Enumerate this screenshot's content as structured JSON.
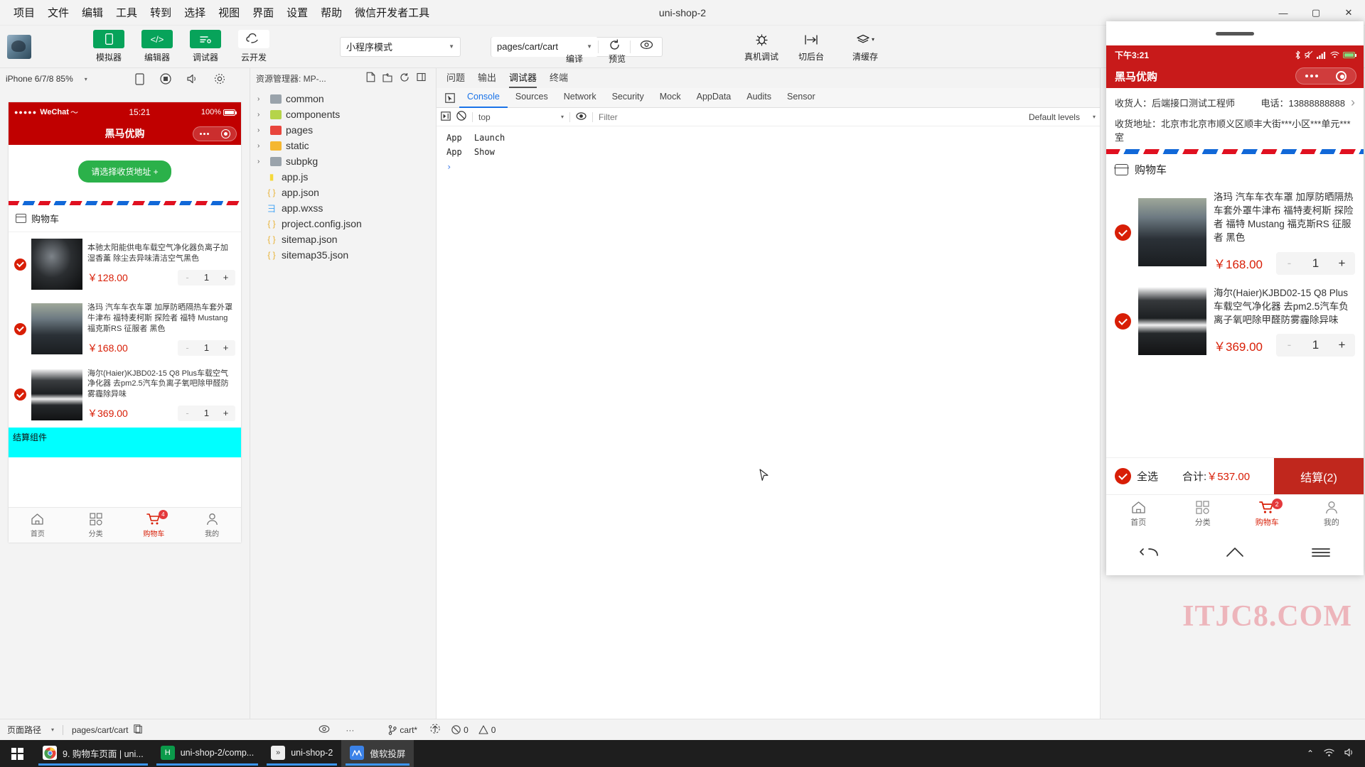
{
  "window": {
    "title": "uni-shop-2",
    "controls": {
      "minimize": "—",
      "maximize": "▢",
      "close": "✕"
    }
  },
  "menubar": [
    "项目",
    "文件",
    "编辑",
    "工具",
    "转到",
    "选择",
    "视图",
    "界面",
    "设置",
    "帮助",
    "微信开发者工具"
  ],
  "toolbar": {
    "tools": [
      {
        "label": "模拟器",
        "icon": "phone-icon"
      },
      {
        "label": "编辑器",
        "icon": "code-icon"
      },
      {
        "label": "调试器",
        "icon": "debug-icon"
      },
      {
        "label": "云开发",
        "icon": "cloud-icon"
      }
    ],
    "mode_select": "小程序模式",
    "page_select": "pages/cart/cart",
    "compile": {
      "label": "编译",
      "icon": "refresh-icon"
    },
    "preview": {
      "label": "预览",
      "icon": "eye-icon"
    },
    "actions": [
      {
        "label": "真机调试",
        "icon": "bug-icon"
      },
      {
        "label": "切后台",
        "icon": "switch-icon"
      },
      {
        "label": "清缓存",
        "icon": "layers-icon",
        "caret": "▾"
      }
    ]
  },
  "simulator": {
    "device": "iPhone 6/7/8 85%",
    "device_caret": "▾",
    "icons": [
      "phone-rotate-icon",
      "record-icon",
      "volume-icon",
      "settings-icon"
    ],
    "status": {
      "carrier": "WeChat",
      "dots": "●●●●●",
      "time": "15:21",
      "battery": "100%"
    },
    "nav_title": "黑马优购",
    "address_button": "请选择收货地址 +",
    "cart_header": "购物车",
    "items": [
      {
        "name": "本驰太阳能供电车载空气净化器负离子加湿香薰 除尘去异味清洁空气黑色",
        "price": "￥128.00",
        "qty": "1",
        "minus": "-",
        "plus": "+",
        "checked": true,
        "thumb": "t1"
      },
      {
        "name": "洛玛 汽车车衣车罩 加厚防晒隔热车套外罩牛津布 福特麦柯斯 探险者 福特 Mustang 福克斯RS 征服者 黑色",
        "price": "￥168.00",
        "qty": "1",
        "minus": "-",
        "plus": "+",
        "checked": true,
        "thumb": "t2"
      },
      {
        "name": "海尔(Haier)KJBD02-15 Q8 Plus车载空气净化器 去pm2.5汽车负离子氧吧除甲醛防雾霾除异味",
        "price": "￥369.00",
        "qty": "1",
        "minus": "-",
        "plus": "+",
        "checked": true,
        "thumb": "t3"
      }
    ],
    "settle_component": "结算组件",
    "tabbar": [
      {
        "label": "首页",
        "icon": "home-icon",
        "active": false,
        "badge": ""
      },
      {
        "label": "分类",
        "icon": "grid-icon",
        "active": false,
        "badge": ""
      },
      {
        "label": "购物车",
        "icon": "cart-icon",
        "active": true,
        "badge": "4"
      },
      {
        "label": "我的",
        "icon": "user-icon",
        "active": false,
        "badge": ""
      }
    ]
  },
  "explorer": {
    "title": "资源管理器: MP-...",
    "head_icons": [
      "new-file-icon",
      "new-folder-icon",
      "refresh-icon",
      "collapse-icon"
    ],
    "tree": [
      {
        "label": "common",
        "type": "folder",
        "color": "#9aa3ab",
        "arrow": "›"
      },
      {
        "label": "components",
        "type": "folder",
        "color": "#b5d44a",
        "arrow": "›"
      },
      {
        "label": "pages",
        "type": "folder",
        "color": "#e8453c",
        "arrow": "›"
      },
      {
        "label": "static",
        "type": "folder",
        "color": "#f5b731",
        "arrow": "›"
      },
      {
        "label": "subpkg",
        "type": "folder",
        "color": "#9aa3ab",
        "arrow": "›"
      },
      {
        "label": "app.js",
        "type": "js",
        "color": "#f5d93a",
        "glyph": "▮"
      },
      {
        "label": "app.json",
        "type": "json",
        "color": "#e8b339",
        "glyph": "{ }"
      },
      {
        "label": "app.wxss",
        "type": "wxss",
        "color": "#3aa0f5",
        "glyph": "彐"
      },
      {
        "label": "project.config.json",
        "type": "json",
        "color": "#e8b339",
        "glyph": "{ }"
      },
      {
        "label": "sitemap.json",
        "type": "json",
        "color": "#e8b339",
        "glyph": "{ }"
      },
      {
        "label": "sitemap35.json",
        "type": "json",
        "color": "#e8b339",
        "glyph": "{ }"
      }
    ]
  },
  "devtools": {
    "panel_tabs": [
      {
        "label": "问题",
        "active": false
      },
      {
        "label": "输出",
        "active": false
      },
      {
        "label": "调试器",
        "active": true
      },
      {
        "label": "终端",
        "active": false
      }
    ],
    "inspect_icon": "inspect-icon",
    "tabs": [
      {
        "label": "Console",
        "active": true
      },
      {
        "label": "Sources",
        "active": false
      },
      {
        "label": "Network",
        "active": false
      },
      {
        "label": "Security",
        "active": false
      },
      {
        "label": "Mock",
        "active": false
      },
      {
        "label": "AppData",
        "active": false
      },
      {
        "label": "Audits",
        "active": false
      },
      {
        "label": "Sensor",
        "active": false
      }
    ],
    "console_bar": {
      "exec_icon": "execute-icon",
      "clear_icon": "clear-icon",
      "context": "top",
      "context_caret": "▾",
      "eye_icon": "eye-icon",
      "filter_placeholder": "Filter",
      "levels": "Default levels",
      "levels_caret": "▾"
    },
    "logs": [
      {
        "key": "App",
        "text": "Launch"
      },
      {
        "key": "App",
        "text": "Show"
      }
    ],
    "prompt": "›"
  },
  "mirror": {
    "status": {
      "time": "下午3:21",
      "icons": [
        "bluetooth-icon",
        "mute-icon",
        "signal-icon",
        "wifi-icon",
        "battery-icon"
      ]
    },
    "nav_title": "黑马优购",
    "address": {
      "receiver_label": "收货人：后端接口测试工程师",
      "phone_label": "电话：13888888888",
      "chevron": "›",
      "address_label": "收货地址：北京市北京市顺义区顺丰大街***小区***单元***室"
    },
    "cart_header": "购物车",
    "items": [
      {
        "name": "洛玛 汽车车衣车罩 加厚防晒隔热车套外罩牛津布 福特麦柯斯 探险者 福特 Mustang 福克斯RS 征服者 黑色",
        "price": "￥168.00",
        "qty": "1",
        "minus": "-",
        "plus": "+",
        "checked": true,
        "thumb": "t2"
      },
      {
        "name": "海尔(Haier)KJBD02-15 Q8 Plus车载空气净化器 去pm2.5汽车负离子氧吧除甲醛防雾霾除异味",
        "price": "￥369.00",
        "qty": "1",
        "minus": "-",
        "plus": "+",
        "checked": true,
        "thumb": "t3"
      }
    ],
    "settle": {
      "select_all": "全选",
      "total_label": "合计:",
      "total_value": "￥537.00",
      "button": "结算(2)"
    },
    "tabbar": [
      {
        "label": "首页",
        "icon": "home-icon",
        "active": false,
        "badge": ""
      },
      {
        "label": "分类",
        "icon": "grid-icon",
        "active": false,
        "badge": ""
      },
      {
        "label": "购物车",
        "icon": "cart-icon",
        "active": true,
        "badge": "2"
      },
      {
        "label": "我的",
        "icon": "user-icon",
        "active": false,
        "badge": ""
      }
    ],
    "sysnav": [
      "back-icon",
      "home-icon",
      "menu-icon"
    ],
    "watermark": "ITJC8.COM"
  },
  "statusbar": {
    "path_label": "页面路径",
    "path_caret": "▾",
    "path_value": "pages/cart/cart",
    "copy_icon": "copy-icon",
    "eye_icon": "eye-icon",
    "more": "···",
    "branch_icon": "branch-icon",
    "branch": "cart*",
    "sync_icon": "sync-icon",
    "errors_icon": "error-icon",
    "errors": "0",
    "warnings_icon": "warning-icon",
    "warnings": "0"
  },
  "taskbar": {
    "start_icon": "windows-icon",
    "apps": [
      {
        "label": "9. 购物车页面 | uni...",
        "icon": "chrome-icon",
        "color": "#f5f5f5",
        "glyph": "◉",
        "active": false
      },
      {
        "label": "uni-shop-2/comp...",
        "icon": "hbuilder-icon",
        "color": "#0b9a4a",
        "glyph": "H",
        "active": false
      },
      {
        "label": "uni-shop-2",
        "icon": "devtools-icon",
        "color": "#f0f0f0",
        "glyph": "»",
        "active": false
      },
      {
        "label": "傲软投屏",
        "icon": "apowermirror-icon",
        "color": "#3b82e8",
        "glyph": "ᨓ",
        "active": true
      }
    ],
    "tray": [
      "chevron-up-icon",
      "network-icon",
      "volume-icon"
    ]
  },
  "colors": {
    "brand_green": "#07a35a",
    "mp_red": "#c00000",
    "mirror_red": "#c81a1a",
    "price_red": "#d81e06",
    "accent_blue": "#1a73e8",
    "settle_cyan": "#00ffff"
  }
}
